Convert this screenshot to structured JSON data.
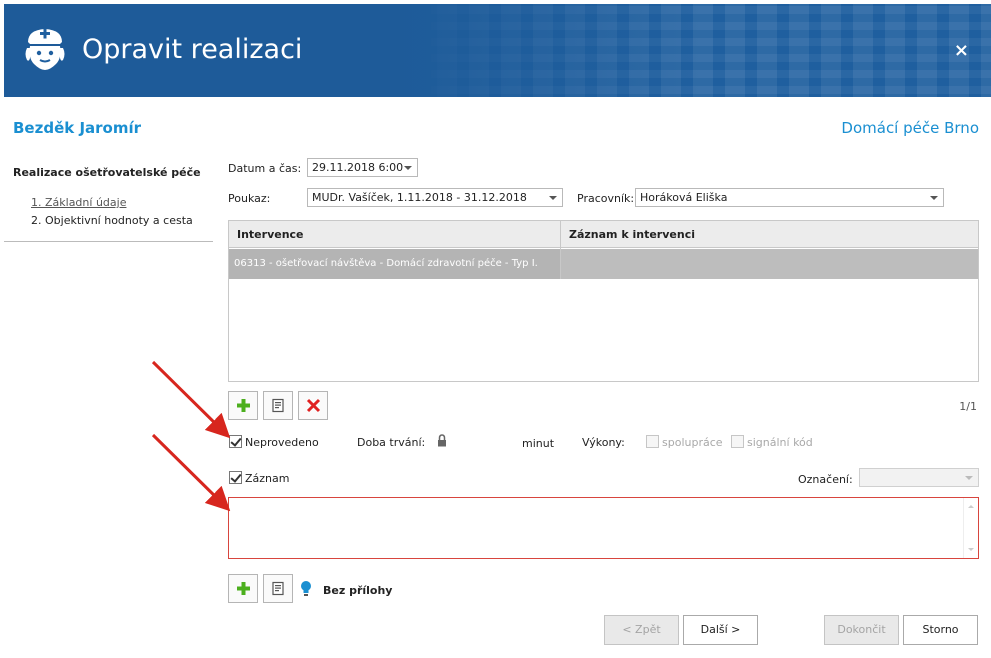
{
  "window": {
    "title": "Opravit realizaci",
    "close_glyph": "×"
  },
  "patient_name": "Bezděk Jaromír",
  "organization": "Domácí péče Brno",
  "sidebar": {
    "title": "Realizace ošetřovatelské péče",
    "steps": [
      {
        "label": "1. Základní údaje",
        "active": true
      },
      {
        "label": "2. Objektivní hodnoty a cesta",
        "active": false
      }
    ]
  },
  "form": {
    "datetime_label": "Datum a čas:",
    "datetime_value": "29.11.2018 6:00",
    "voucher_label": "Poukaz:",
    "voucher_value": "MUDr. Vašíček, 1.11.2018 - 31.12.2018",
    "worker_label": "Pracovník:",
    "worker_value": "Horáková Eliška"
  },
  "grid": {
    "columns": [
      "Intervence",
      "Záznam k intervenci"
    ],
    "rows": [
      {
        "intervention": "06313 - ošetřovací návštěva - Domácí zdravotní péče - Typ I.",
        "record": ""
      }
    ],
    "pager": "1/1"
  },
  "options": {
    "not_performed_label": "Neprovedeno",
    "not_performed_checked": true,
    "duration_label": "Doba trvání:",
    "duration_unit": "minut",
    "performances_label": "Výkony:",
    "cooperation_label": "spolupráce",
    "signal_code_label": "signální kód",
    "record_label": "Záznam",
    "record_checked": true,
    "marking_label": "Označení:",
    "marking_value": ""
  },
  "attachments": {
    "label": "Bez přílohy"
  },
  "footer": {
    "back_label": "< Zpět",
    "next_label": "Další >",
    "finish_label": "Dokončit",
    "cancel_label": "Storno"
  },
  "colors": {
    "header_bg": "#1f5f9f",
    "accent": "#1a8fd1",
    "annotation_red": "#d7261e",
    "add_green": "#4caf1e",
    "delete_red": "#e02020"
  }
}
